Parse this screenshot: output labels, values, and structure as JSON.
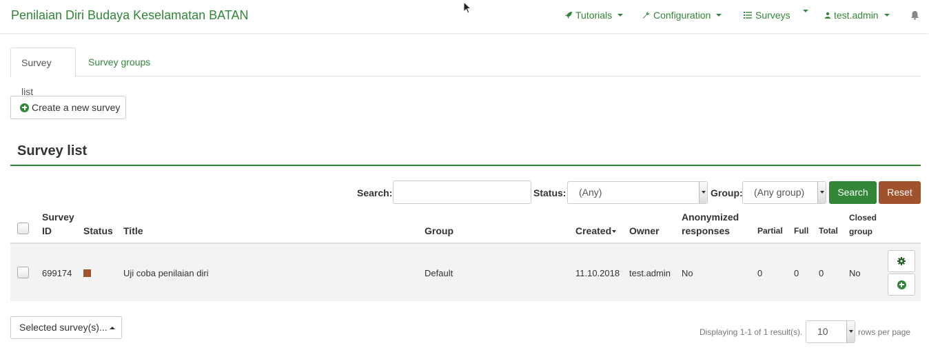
{
  "navbar": {
    "brand": "Penilaian Diri Budaya Keselamatan BATAN",
    "tutorials": "Tutorials",
    "configuration": "Configuration",
    "surveys": "Surveys",
    "user": "test.admin"
  },
  "tabs": {
    "survey_list": "Survey list",
    "survey_groups": "Survey groups"
  },
  "actions": {
    "create_survey": "Create a new survey"
  },
  "section": {
    "title": "Survey list"
  },
  "filters": {
    "search_label": "Search:",
    "search_value": "",
    "status_label": "Status:",
    "status_value": "(Any)",
    "group_label": "Group:",
    "group_value": "(Any group)",
    "search_button": "Search",
    "reset_button": "Reset"
  },
  "table": {
    "headers": {
      "survey_id_1": "Survey",
      "survey_id_2": "ID",
      "status": "Status",
      "title": "Title",
      "group": "Group",
      "created": "Created",
      "owner": "Owner",
      "anonymized_1": "Anonymized",
      "anonymized_2": "responses",
      "partial": "Partial",
      "full": "Full",
      "total": "Total",
      "closed_1": "Closed",
      "closed_2": "group"
    },
    "rows": [
      {
        "survey_id": "699174",
        "status": "inactive",
        "title": "Uji coba penilaian diri",
        "group": "Default",
        "created": "11.10.2018",
        "owner": "test.admin",
        "anonymized": "No",
        "partial": "0",
        "full": "0",
        "total": "0",
        "closed_group": "No"
      }
    ]
  },
  "footer": {
    "selected_button": "Selected survey(s)...",
    "summary": "Displaying 1-1 of 1 result(s).",
    "page_size": "10",
    "rows_per_page": "rows per page"
  },
  "colors": {
    "brand_green": "#328637",
    "reset_brown": "#a0522d",
    "status_inactive": "#a0522d"
  },
  "icons": {
    "tutorials": "rocket-icon",
    "configuration": "wrench-icon",
    "surveys": "list-icon",
    "user": "user-icon",
    "notifications": "bell-icon",
    "create": "plus-circle-icon",
    "row_settings": "gear-icon",
    "row_add": "plus-circle-icon"
  }
}
